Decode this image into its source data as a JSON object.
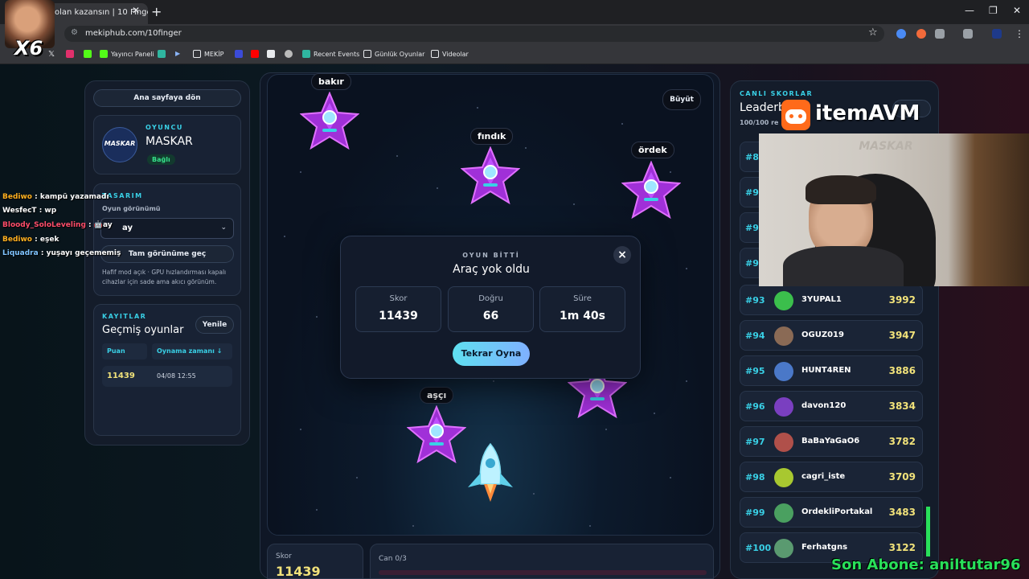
{
  "browser": {
    "tab_title": "olan kazansın | 10 Finger |",
    "url": "mekiphub.com/10finger",
    "bookmarks": [
      "Yayıncı Paneli",
      "MEKİP",
      "Recent Events",
      "Günlük Oyunlar",
      "Videolar"
    ]
  },
  "overlay": {
    "multiplier": "X6",
    "sponsor_brand": "itemAVM",
    "last_subscriber": "Son Abone: aniltutar96",
    "chat": [
      {
        "user": "Bediwo",
        "message": ": kampü yazamadı",
        "user_color": "#ffb020"
      },
      {
        "user": "WesfecT",
        "message": ": wp",
        "user_color": "#ffffff"
      },
      {
        "user": "Bloody_SoloLeveling",
        "message": ": 🤖ay",
        "user_color": "#ff4d6a"
      },
      {
        "user": "Bediwo",
        "message": ": eşek",
        "user_color": "#ffb020"
      },
      {
        "user": "Liquadra",
        "message": ": yuşayı geçememiş",
        "user_color": "#7fc4ff"
      }
    ]
  },
  "left": {
    "home_button": "Ana sayfaya dön",
    "player": {
      "eyebrow": "OYUNCU",
      "name": "MASKAR",
      "status": "Bağlı",
      "logo_text": "MASKAR"
    },
    "design": {
      "eyebrow": "TASARIM",
      "label": "Oyun görünümü",
      "select_value": "ay",
      "fullscreen_button": "Tam görünüme geç",
      "note": "Hafif mod açık · GPU hızlandırması kapalı cihazlar için sade ama akıcı görünüm."
    },
    "records": {
      "eyebrow": "KAYITLAR",
      "title": "Geçmiş oyunlar",
      "refresh_button": "Yenile",
      "col_score": "Puan",
      "col_time": "Oynama zamanı ↓",
      "rows": [
        {
          "score": "11439",
          "time": "04/08 12:55"
        }
      ]
    }
  },
  "game": {
    "enlarge_button": "Büyüt",
    "words": [
      "bakır",
      "fındık",
      "ördek",
      "aşçı"
    ],
    "modal": {
      "eyebrow": "OYUN BİTTİ",
      "title": "Araç yok oldu",
      "close_icon": "×",
      "stats": [
        {
          "label": "Skor",
          "value": "11439"
        },
        {
          "label": "Doğru",
          "value": "66"
        },
        {
          "label": "Süre",
          "value": "1m 40s"
        }
      ],
      "replay_button": "Tekrar Oyna"
    },
    "bottom": {
      "score_label": "Skor",
      "score_value": "11439",
      "lives_label": "Can 0/3"
    }
  },
  "leaderboard": {
    "eyebrow": "CANLI SKORLAR",
    "title": "Leaderb",
    "subtitle": "100/100 re",
    "partial_ranks": [
      "#89",
      "#90",
      "#91",
      "#92"
    ],
    "rows": [
      {
        "rank": "#93",
        "name": "3YUPAL1",
        "score": "3992",
        "avatar_color": "#3bbf4c"
      },
      {
        "rank": "#94",
        "name": "OGUZ019",
        "score": "3947",
        "avatar_color": "#8a6a55"
      },
      {
        "rank": "#95",
        "name": "HUNT4REN",
        "score": "3886",
        "avatar_color": "#4a78c8"
      },
      {
        "rank": "#96",
        "name": "davon120",
        "score": "3834",
        "avatar_color": "#7a3fc0"
      },
      {
        "rank": "#97",
        "name": "BaBaYaGaO6",
        "score": "3782",
        "avatar_color": "#b0504a"
      },
      {
        "rank": "#98",
        "name": "cagri_iste",
        "score": "3709",
        "avatar_color": "#a8c830"
      },
      {
        "rank": "#99",
        "name": "OrdekliPortakal",
        "score": "3483",
        "avatar_color": "#4aa060"
      },
      {
        "rank": "#100",
        "name": "Ferhatgns",
        "score": "3122",
        "avatar_color": "#5a9a70"
      }
    ]
  }
}
